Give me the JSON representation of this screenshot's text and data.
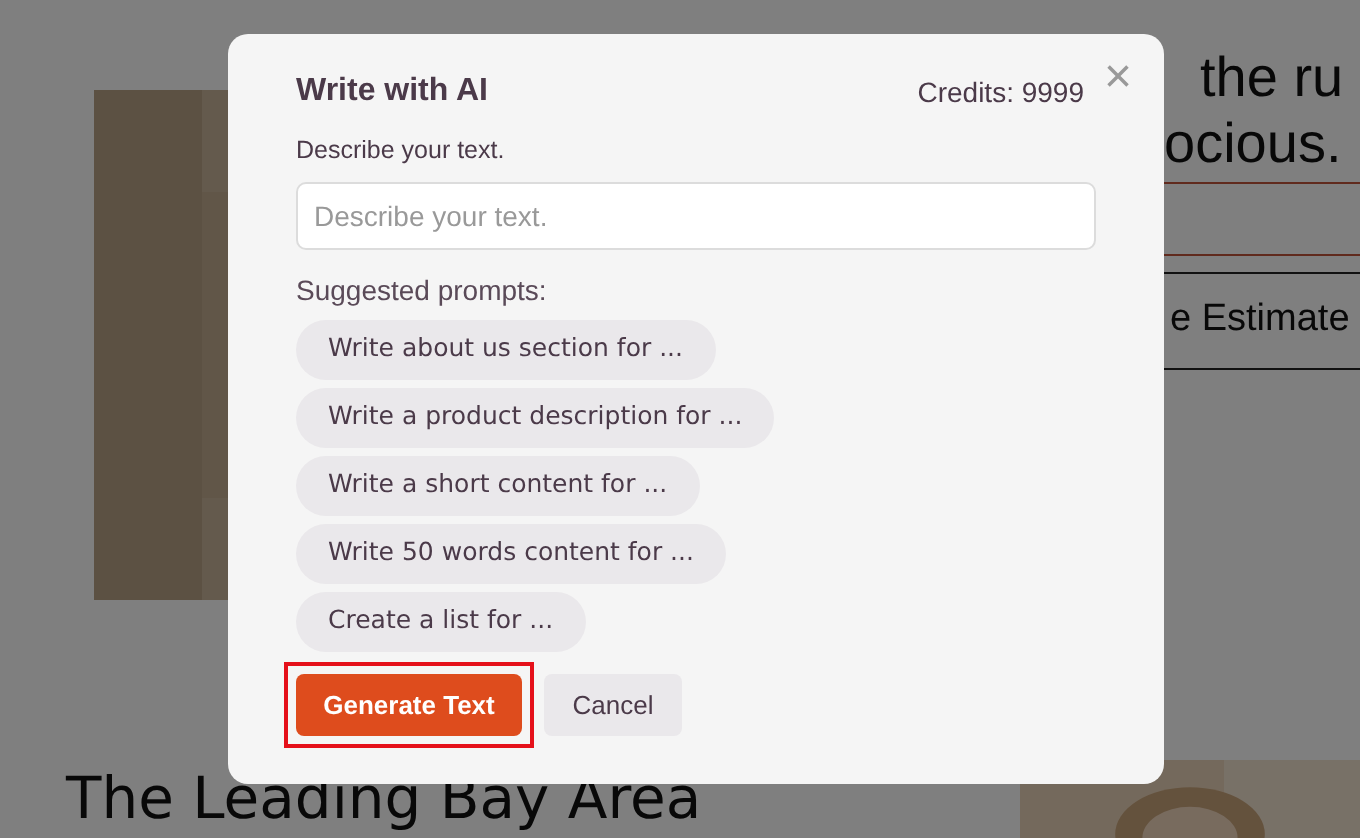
{
  "background_page": {
    "heading_lines": [
      "the ru",
      "ocious."
    ],
    "estimate_button": "e Estimate",
    "section_heading": "The Leading Bay Area"
  },
  "dialog": {
    "title": "Write with AI",
    "credits": "Credits: 9999",
    "close": "×",
    "field_label": "Describe your text.",
    "field": {
      "placeholder": "Describe your text."
    },
    "prompts_label": "Suggested prompts:",
    "prompts": [
      "Write about us section for ...",
      "Write a product description for ...",
      "Write a short content for ...",
      "Write 50 words content for ...",
      "Create a list for ..."
    ],
    "buttons": [
      {
        "label": "Generate Text",
        "kind": "primary",
        "highlighted": true
      },
      {
        "label": "Cancel",
        "kind": "secondary",
        "highlighted": false
      }
    ]
  }
}
